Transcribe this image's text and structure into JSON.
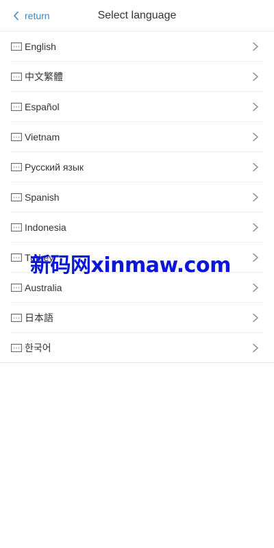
{
  "header": {
    "back_label": "return",
    "title": "Select language"
  },
  "languages": [
    {
      "label": "English"
    },
    {
      "label": "中文繁體"
    },
    {
      "label": "Español"
    },
    {
      "label": "Vietnam"
    },
    {
      "label": "Русский язык"
    },
    {
      "label": "Spanish"
    },
    {
      "label": "Indonesia"
    },
    {
      "label": "Turkey"
    },
    {
      "label": "Australia"
    },
    {
      "label": "日本語"
    },
    {
      "label": "한국어"
    }
  ],
  "icons": {
    "back": "chevron-left-icon",
    "language": "keyboard-icon",
    "row_arrow": "chevron-right-icon"
  },
  "colors": {
    "accent": "#3b86c6",
    "watermark": "#0b17d6",
    "divider": "#efefef"
  },
  "watermark": {
    "text": "新码网xinmaw.com"
  }
}
